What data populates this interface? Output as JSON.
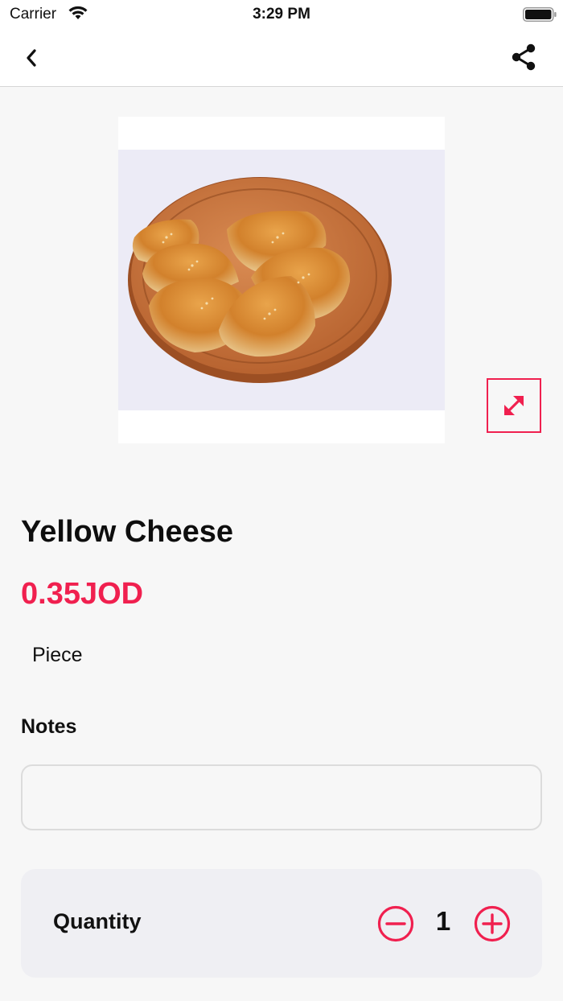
{
  "status_bar": {
    "carrier": "Carrier",
    "time": "3:29 PM",
    "wifi_icon": "wifi-icon",
    "battery_icon": "battery-icon"
  },
  "nav": {
    "back_icon": "chevron-left-icon",
    "share_icon": "share-icon"
  },
  "product": {
    "image_subject": "baked pastries with sesame on wooden board",
    "name": "Yellow Cheese",
    "price": "0.35JOD",
    "unit": "Piece",
    "expand_icon": "expand-arrows-icon"
  },
  "notes": {
    "label": "Notes",
    "value": "",
    "placeholder": ""
  },
  "quantity": {
    "label": "Quantity",
    "value": "1",
    "minus_icon": "minus-circle-icon",
    "plus_icon": "plus-circle-icon"
  },
  "colors": {
    "accent": "#f0204f",
    "background": "#f7f7f7",
    "card": "#efeff3"
  }
}
